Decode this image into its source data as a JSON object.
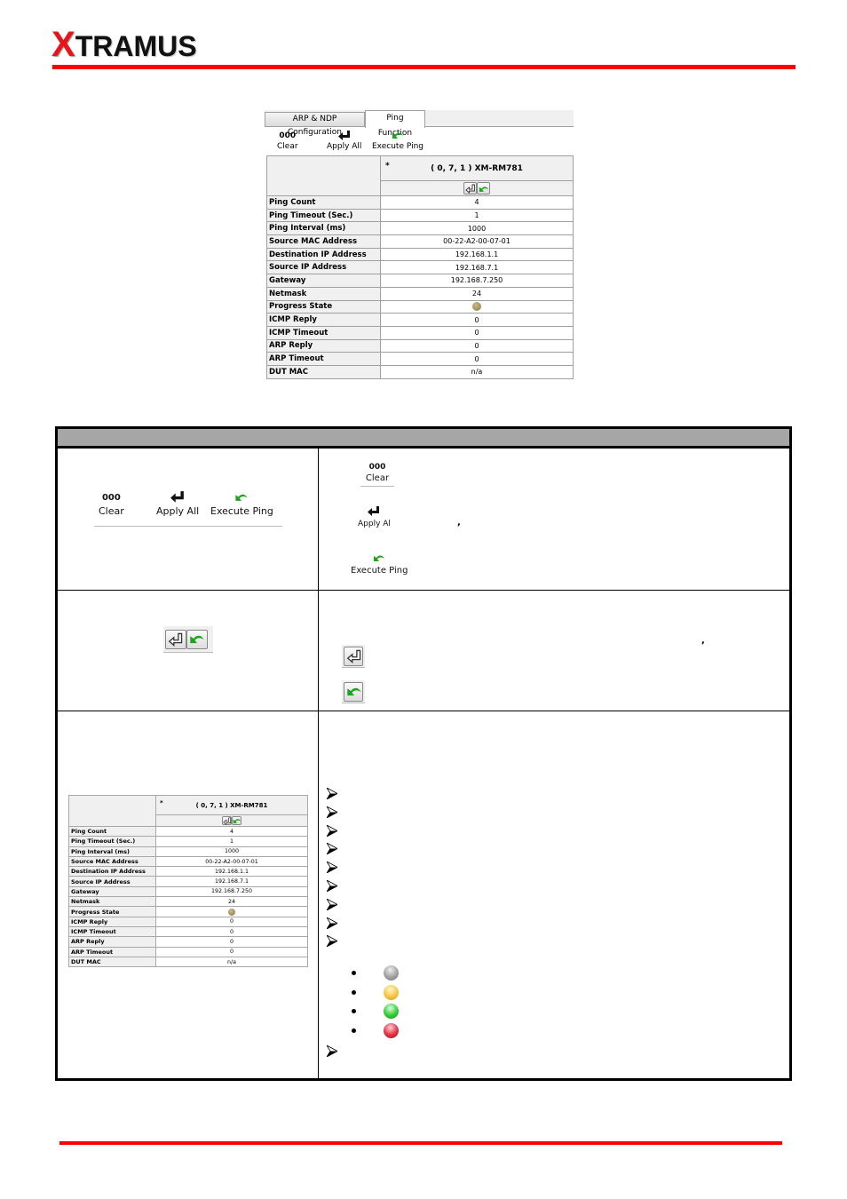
{
  "header": {
    "logo_x": "X",
    "logo_rest": "TRAMUS",
    "brand_color": "#e8141b",
    "rule_color": "#ff0000"
  },
  "panel": {
    "tabs": [
      {
        "label": "ARP & NDP Configuration",
        "active": false
      },
      {
        "label": "Ping Function",
        "active": true
      }
    ],
    "toolbar": {
      "clear_icon": "000",
      "clear_label": "Clear",
      "apply_all_label": "Apply All",
      "execute_ping_label": "Execute Ping"
    },
    "device": {
      "star": "*",
      "name": "( 0, 7, 1 ) XM-RM781"
    },
    "rows": [
      {
        "key": "Ping Count",
        "value": "4"
      },
      {
        "key": "Ping Timeout (Sec.)",
        "value": "1"
      },
      {
        "key": "Ping Interval (ms)",
        "value": "1000"
      },
      {
        "key": "Source MAC Address",
        "value": "00-22-A2-00-07-01"
      },
      {
        "key": "Destination IP Address",
        "value": "192.168.1.1"
      },
      {
        "key": "Source IP Address",
        "value": "192.168.7.1"
      },
      {
        "key": "Gateway",
        "value": "192.168.7.250"
      },
      {
        "key": "Netmask",
        "value": "24"
      },
      {
        "key": "Progress State",
        "value": "",
        "indicator": "olive"
      },
      {
        "key": "ICMP Reply",
        "value": "0"
      },
      {
        "key": "ICMP Timeout",
        "value": "0"
      },
      {
        "key": "ARP Reply",
        "value": "0"
      },
      {
        "key": "ARP Timeout",
        "value": "0"
      },
      {
        "key": "DUT MAC",
        "value": "n/a"
      }
    ]
  },
  "doc": {
    "header_color": "#a6a6a6",
    "row1": {
      "clear_icon": "000",
      "clear_label": "Clear",
      "apply_all_label": "Apply All",
      "apply_all_short_label": "Apply Al",
      "execute_ping_label": "Execute Ping",
      "comma": ","
    },
    "row2": {
      "comma": ","
    },
    "row3": {
      "status_colors": [
        {
          "name": "gray",
          "color": "#a0a0a0"
        },
        {
          "name": "yellow",
          "color": "#f5c542"
        },
        {
          "name": "green",
          "color": "#33cc33"
        },
        {
          "name": "red",
          "color": "#e03040"
        }
      ]
    }
  }
}
